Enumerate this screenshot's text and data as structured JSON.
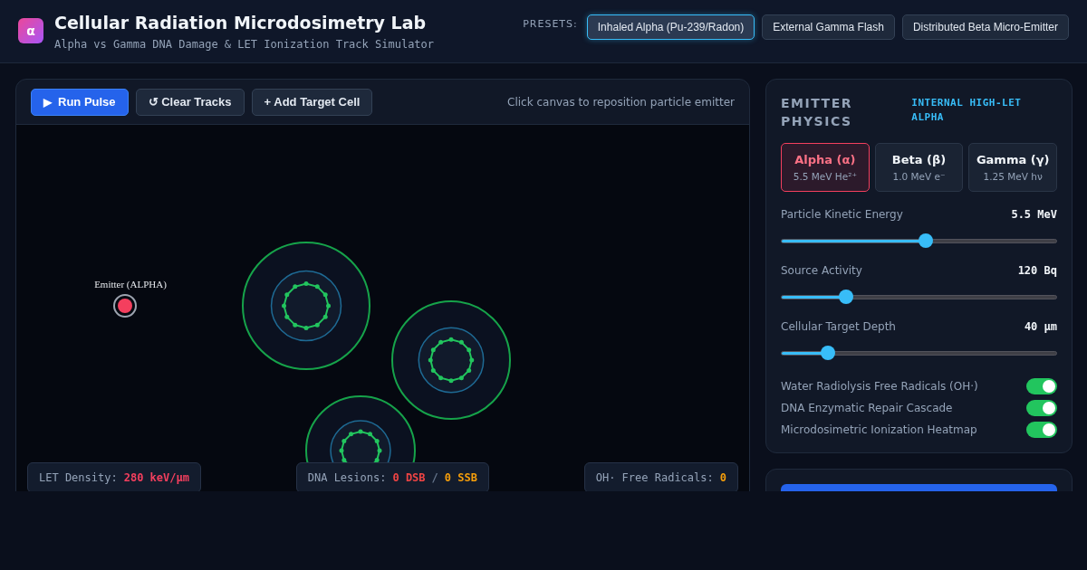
{
  "header": {
    "logo": "α",
    "title": "Cellular Radiation Microdosimetry Lab",
    "subtitle": "Alpha vs Gamma DNA Damage & LET Ionization Track Simulator"
  },
  "presets": {
    "label": "PRESETS:",
    "items": [
      {
        "label": "Inhaled Alpha (Pu-239/Radon)",
        "selected": true
      },
      {
        "label": "External Gamma Flash",
        "selected": false
      },
      {
        "label": "Distributed Beta Micro-Emitter",
        "selected": false
      }
    ]
  },
  "toolbar": {
    "buttons": [
      {
        "icon": "▶",
        "label": "Run Pulse",
        "kind": "primary"
      },
      {
        "label": "↺ Clear Tracks",
        "kind": "secondary"
      },
      {
        "label": "+ Add Target Cell",
        "kind": "secondary"
      }
    ],
    "hint": "Click canvas to reposition particle emitter"
  },
  "canvas": {
    "emitter_label": "Emitter (ALPHA)",
    "stats": [
      {
        "label": "LET Density:",
        "parts": [
          {
            "text": "280 keV/μm",
            "color": "#f43f5e"
          }
        ]
      },
      {
        "label": "DNA Lesions:",
        "parts": [
          {
            "text": "0 DSB",
            "color": "#ef4444"
          },
          {
            "text": "/",
            "color": "#64748b"
          },
          {
            "text": "0 SSB",
            "color": "#f59e0b"
          }
        ]
      },
      {
        "label": "OH· Free Radicals:",
        "parts": [
          {
            "text": "0",
            "color": "#f59e0b"
          }
        ]
      }
    ]
  },
  "physics": {
    "title": "EMITTER PHYSICS",
    "badge": "INTERNAL HIGH-LET ALPHA",
    "particles": [
      {
        "name": "Alpha (α)",
        "detail": "5.5 MeV He²⁺",
        "selected": true
      },
      {
        "name": "Beta (β)",
        "detail": "1.0 MeV e⁻",
        "selected": false
      },
      {
        "name": "Gamma (γ)",
        "detail": "1.25 MeV hν",
        "selected": false
      }
    ],
    "sliders": [
      {
        "label": "Particle Kinetic Energy",
        "reading": "5.5 MeV",
        "level": 0.525
      },
      {
        "label": "Source Activity",
        "reading": "120 Bq",
        "level": 0.235
      },
      {
        "label": "Cellular Target Depth",
        "reading": "40 μm",
        "level": 0.172
      }
    ],
    "toggles": [
      {
        "label": "Water Radiolysis Free Radicals (OH·)",
        "on": true
      },
      {
        "label": "DNA Enzymatic Repair Cascade",
        "on": true
      },
      {
        "label": "Microdosimetric Ionization Heatmap",
        "on": true
      }
    ]
  }
}
